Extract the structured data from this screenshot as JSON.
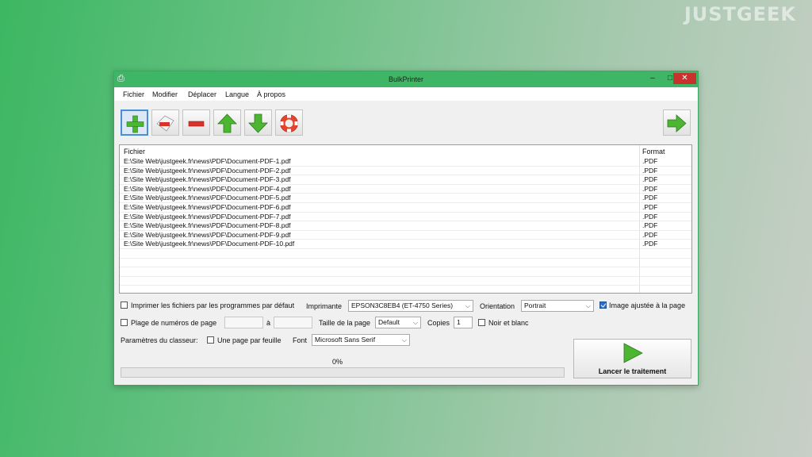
{
  "watermark": "JUSTGEEK",
  "window": {
    "title": "BulkPrinter",
    "minimize": "–",
    "maximize": "□",
    "close": "✕"
  },
  "menu": [
    "Fichier",
    "Modifier",
    "Déplacer",
    "Langue",
    "À propos"
  ],
  "toolbar": {
    "icons": [
      "add-icon",
      "remove-selected-icon",
      "remove-icon",
      "move-up-icon",
      "move-down-icon",
      "help-icon",
      "next-arrow-icon"
    ]
  },
  "file_list": {
    "columns": [
      "Fichier",
      "Format"
    ],
    "rows": [
      {
        "file": "E:\\Site Web\\justgeek.fr\\news\\PDF\\Document-PDF-1.pdf",
        "format": ".PDF"
      },
      {
        "file": "E:\\Site Web\\justgeek.fr\\news\\PDF\\Document-PDF-2.pdf",
        "format": ".PDF"
      },
      {
        "file": "E:\\Site Web\\justgeek.fr\\news\\PDF\\Document-PDF-3.pdf",
        "format": ".PDF"
      },
      {
        "file": "E:\\Site Web\\justgeek.fr\\news\\PDF\\Document-PDF-4.pdf",
        "format": ".PDF"
      },
      {
        "file": "E:\\Site Web\\justgeek.fr\\news\\PDF\\Document-PDF-5.pdf",
        "format": ".PDF"
      },
      {
        "file": "E:\\Site Web\\justgeek.fr\\news\\PDF\\Document-PDF-6.pdf",
        "format": ".PDF"
      },
      {
        "file": "E:\\Site Web\\justgeek.fr\\news\\PDF\\Document-PDF-7.pdf",
        "format": ".PDF"
      },
      {
        "file": "E:\\Site Web\\justgeek.fr\\news\\PDF\\Document-PDF-8.pdf",
        "format": ".PDF"
      },
      {
        "file": "E:\\Site Web\\justgeek.fr\\news\\PDF\\Document-PDF-9.pdf",
        "format": ".PDF"
      },
      {
        "file": "E:\\Site Web\\justgeek.fr\\news\\PDF\\Document-PDF-10.pdf",
        "format": ".PDF"
      }
    ]
  },
  "options": {
    "print_default_programs": {
      "label": "Imprimer les fichiers par les programmes par défaut",
      "checked": false
    },
    "printer_label": "Imprimante",
    "printer_value": "EPSON3C8EB4 (ET-4750 Series)",
    "orientation_label": "Orientation",
    "orientation_value": "Portrait",
    "fit_image": {
      "label": "Image ajustée à la page",
      "checked": true
    },
    "page_range": {
      "label": "Plage de numéros de page",
      "checked": false
    },
    "range_from": "",
    "range_sep": "à",
    "range_to": "",
    "page_size_label": "Taille de la page",
    "page_size_value": "Default",
    "copies_label": "Copies",
    "copies_value": "1",
    "bw": {
      "label": "Noir et blanc",
      "checked": false
    },
    "workbook_label": "Paramètres du classeur:",
    "one_page": {
      "label": "Une page par feuille",
      "checked": false
    },
    "font_label": "Font",
    "font_value": "Microsoft Sans Serif"
  },
  "progress": {
    "text": "0%",
    "value": 0
  },
  "launch_label": "Lancer le traitement",
  "colors": {
    "title_green": "#3fb566",
    "close_red": "#c9312c",
    "icon_green": "#4cb532",
    "icon_red": "#d8322a"
  }
}
